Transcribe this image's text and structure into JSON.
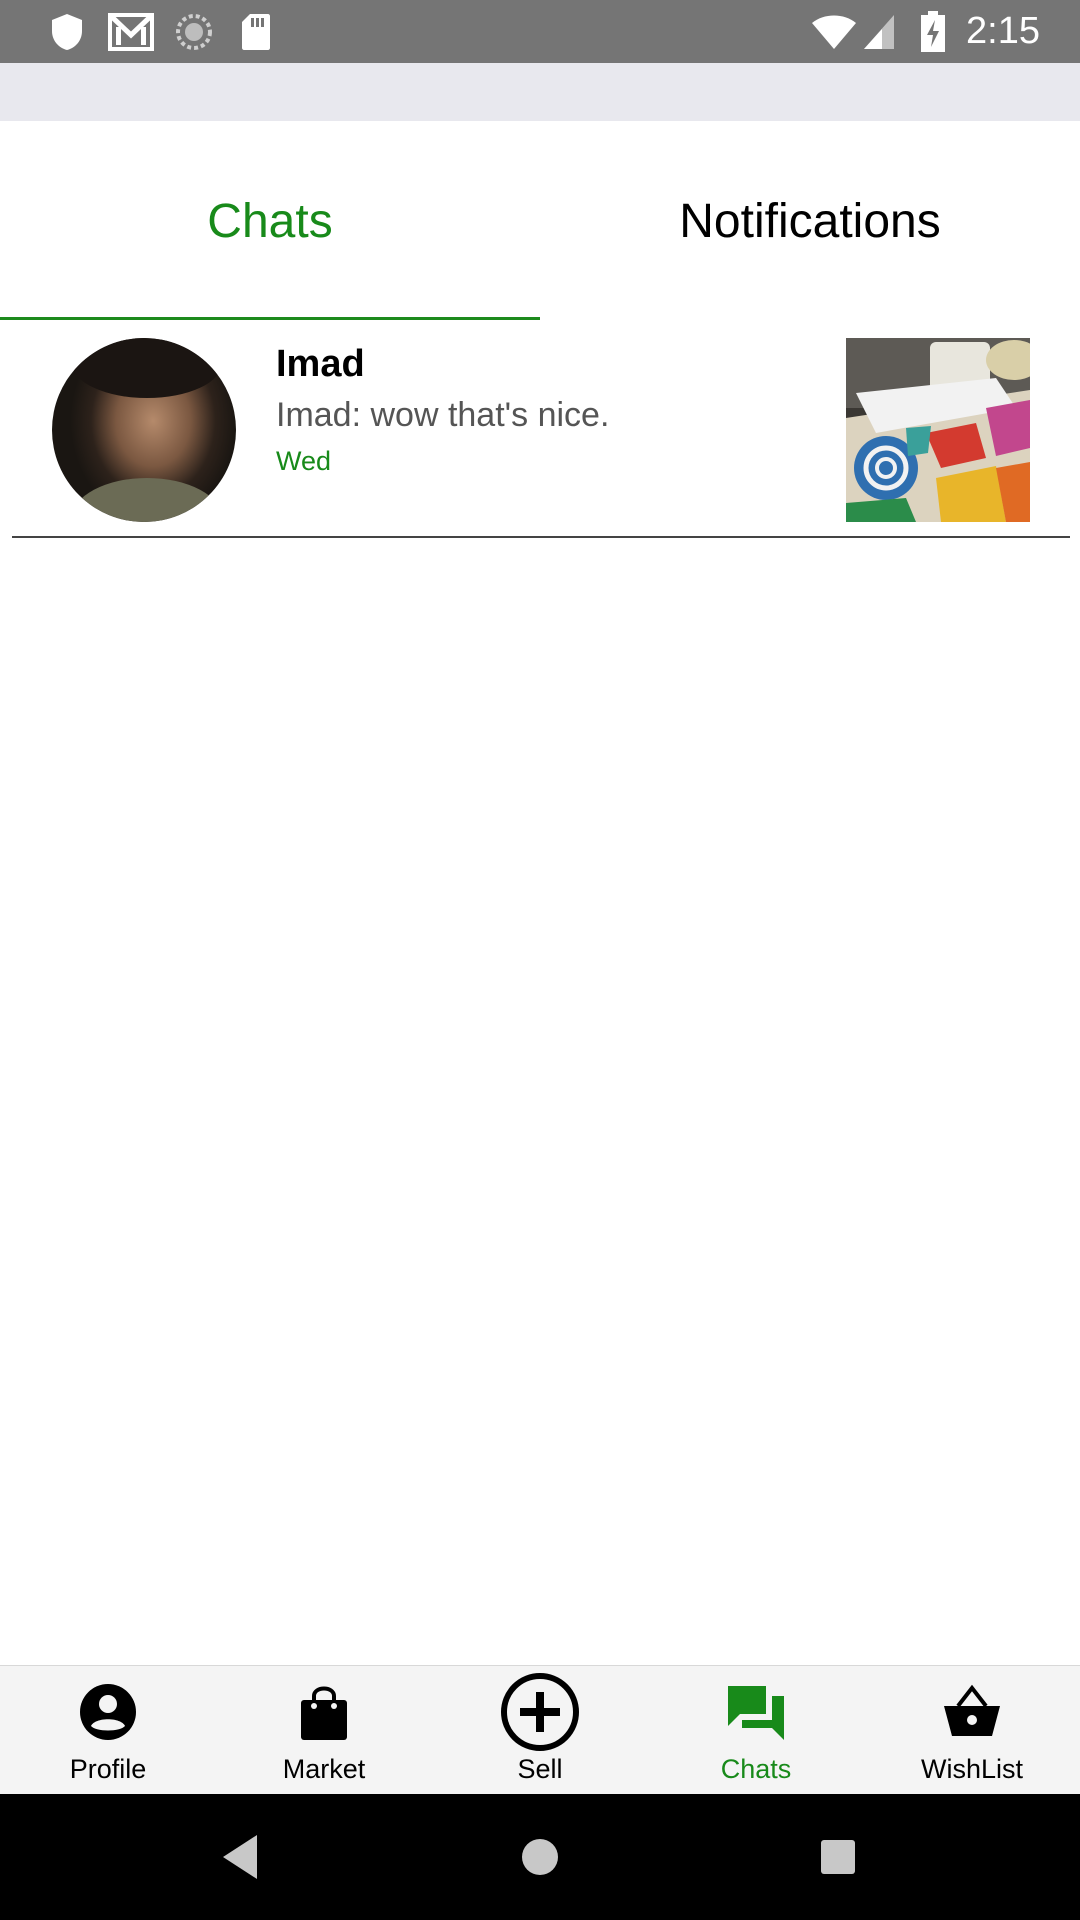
{
  "status_bar": {
    "time": "2:15",
    "left_icons": [
      "shield-icon",
      "gmail-icon",
      "sync-icon",
      "sd-card-icon"
    ],
    "right_icons": [
      "wifi-icon",
      "signal-icon",
      "battery-charging-icon"
    ]
  },
  "tabs": [
    {
      "label": "Chats",
      "active": true
    },
    {
      "label": "Notifications",
      "active": false
    }
  ],
  "chats": [
    {
      "name": "Imad",
      "last_message": "Imad: wow that's nice.",
      "time": "Wed"
    }
  ],
  "bottom_nav": [
    {
      "label": "Profile",
      "icon": "profile-icon",
      "active": false
    },
    {
      "label": "Market",
      "icon": "shopping-bag-icon",
      "active": false
    },
    {
      "label": "Sell",
      "icon": "add-circle-icon",
      "active": false
    },
    {
      "label": "Chats",
      "icon": "chat-icon",
      "active": true
    },
    {
      "label": "WishList",
      "icon": "basket-icon",
      "active": false
    }
  ],
  "colors": {
    "accent": "#188a1a",
    "status_bar": "#757575",
    "app_strip": "#e8e8ee",
    "nav_bg": "#f4f4f4"
  }
}
